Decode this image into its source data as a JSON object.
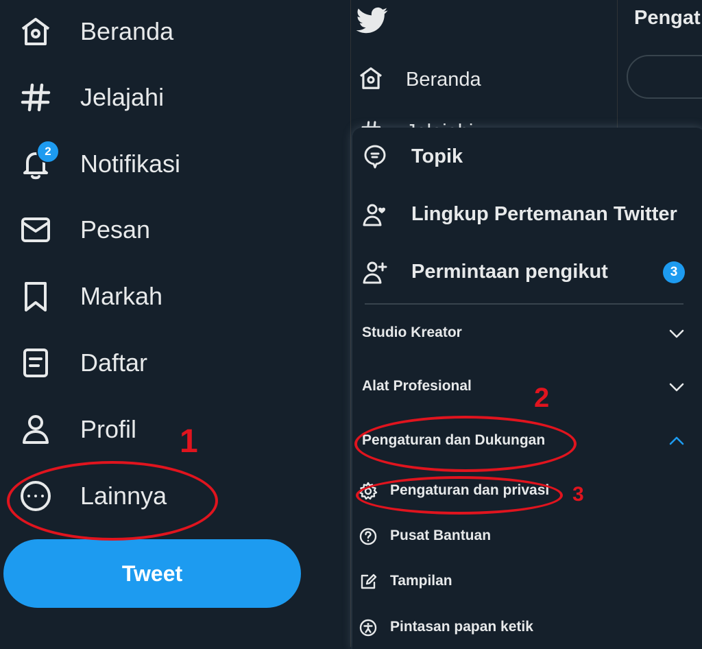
{
  "sidebar": {
    "items": [
      {
        "label": "Beranda",
        "icon": "home-icon"
      },
      {
        "label": "Jelajahi",
        "icon": "hashtag-icon"
      },
      {
        "label": "Notifikasi",
        "icon": "bell-icon",
        "badge": "2"
      },
      {
        "label": "Pesan",
        "icon": "envelope-icon"
      },
      {
        "label": "Markah",
        "icon": "bookmark-icon"
      },
      {
        "label": "Daftar",
        "icon": "list-icon"
      },
      {
        "label": "Profil",
        "icon": "person-icon"
      },
      {
        "label": "Lainnya",
        "icon": "more-circle-icon"
      }
    ],
    "tweet_label": "Tweet"
  },
  "middle": {
    "logo": "twitter-bird-icon",
    "home_label": "Beranda",
    "peek_label": "Jelajahi"
  },
  "right": {
    "title": "Pengat"
  },
  "menu": {
    "primary": [
      {
        "label": "Topik",
        "icon": "topic-bubble-icon"
      },
      {
        "label": "Lingkup Pertemanan Twitter",
        "icon": "person-heart-icon"
      },
      {
        "label": "Permintaan pengikut",
        "icon": "person-plus-icon",
        "badge": "3"
      }
    ],
    "sections": [
      {
        "label": "Studio Kreator",
        "state": "collapsed"
      },
      {
        "label": "Alat Profesional",
        "state": "collapsed"
      },
      {
        "label": "Pengaturan dan Dukungan",
        "state": "expanded"
      }
    ],
    "sub_items": [
      {
        "label": "Pengaturan dan privasi",
        "icon": "gear-icon"
      },
      {
        "label": "Pusat Bantuan",
        "icon": "help-circle-icon"
      },
      {
        "label": "Tampilan",
        "icon": "edit-square-icon"
      },
      {
        "label": "Pintasan papan ketik",
        "icon": "accessibility-icon"
      }
    ]
  },
  "annotations": {
    "one": "1",
    "two": "2",
    "three": "3"
  },
  "colors": {
    "background": "#15202b",
    "accent": "#1d9bf0",
    "text": "#e7e9ea",
    "annotation": "#e0141e"
  }
}
